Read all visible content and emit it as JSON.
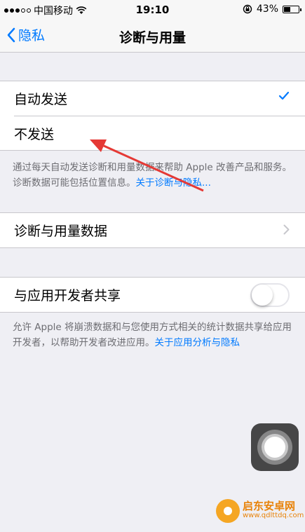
{
  "status_bar": {
    "carrier": "中国移动",
    "time": "19:10",
    "battery": "43%",
    "battery_level": 0.43
  },
  "nav": {
    "back_label": "隐私",
    "title": "诊断与用量"
  },
  "send_group": {
    "options": [
      {
        "label": "自动发送",
        "selected": true
      },
      {
        "label": "不发送",
        "selected": false
      }
    ]
  },
  "send_footer": {
    "text": "通过每天自动发送诊断和用量数据来帮助 Apple 改善产品和服务。诊断数据可能包括位置信息。",
    "link": "关于诊断与隐私..."
  },
  "data_row": {
    "label": "诊断与用量数据"
  },
  "share_row": {
    "label": "与应用开发者共享",
    "enabled": false
  },
  "share_footer": {
    "text": "允许 Apple 将崩溃数据和与您使用方式相关的统计数据共享给应用开发者，以帮助开发者改进应用。",
    "link": "关于应用分析与隐私"
  },
  "watermark": {
    "name": "启东安卓网",
    "url": "www.qdlttdq.com"
  },
  "colors": {
    "accent": "#007aff",
    "arrow": "#e53935",
    "background": "#efeff4"
  }
}
